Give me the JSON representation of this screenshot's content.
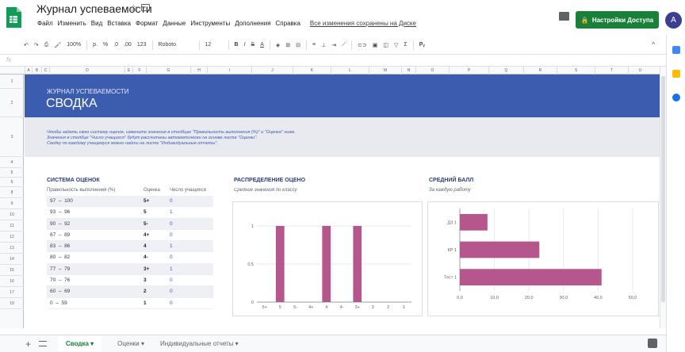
{
  "app": {
    "doc_title": "Журнал успеваемости",
    "menu": [
      "Файл",
      "Изменить",
      "Вид",
      "Вставка",
      "Формат",
      "Данные",
      "Инструменты",
      "Дополнения",
      "Справка"
    ],
    "saved_status": "Все изменения сохранены на Диске",
    "share_label": "Настройки Доступа",
    "avatar_letter": "A",
    "colors": {
      "share": "#188038",
      "header_band": "#3c5cb0",
      "bar": "#b5568c",
      "avatar": "#3c3f8f"
    }
  },
  "toolbar": {
    "zoom": "100%",
    "currency": "р.",
    "percent": "%",
    "dec_less": ".0",
    "dec_more": ".00",
    "format": "123",
    "font": "Roboto",
    "size": "12",
    "bold": "B",
    "italic": "I",
    "strike": "S",
    "underline": "A"
  },
  "formula_bar": {
    "fx": "fx"
  },
  "columns": [
    "A",
    "B",
    "C",
    "D",
    "E",
    "F",
    "G",
    "H",
    "I",
    "J",
    "K",
    "L",
    "M",
    "N",
    "O",
    "P",
    "Q",
    "R",
    "S",
    "T",
    "U"
  ],
  "rows": [
    "1",
    "2",
    "3",
    "4",
    "5",
    "6",
    "8",
    "9",
    "10",
    "11",
    "12",
    "13",
    "14",
    "15",
    "16",
    "17",
    "19"
  ],
  "header": {
    "kicker": "ЖУРНАЛ УСПЕВАЕМОСТИ",
    "title": "СВОДКА"
  },
  "instructions": [
    "Чтобы задать свою систему оценок, измените значения в столбцах \"Правильность выполнения (%)\" и \"Оценка\" ниже.",
    "Значения в столбце \"Число учащихся\" будут рассчитаны автоматически на основе листа \"Оценки\".",
    "Сводку по каждому учащемуся можно найти на листе \"Индивидуальные отчеты\"."
  ],
  "grading": {
    "title": "СИСТЕМА ОЦЕНОК",
    "col_range": "Правильность выполнения (%)",
    "col_grade": "Оценка",
    "col_count": "Число учащихся",
    "rows": [
      {
        "range": "97  –  100",
        "grade": "5+",
        "count": "0"
      },
      {
        "range": "93  –  96",
        "grade": "5",
        "count": "1"
      },
      {
        "range": "90  –  92",
        "grade": "5-",
        "count": "0"
      },
      {
        "range": "87  –  89",
        "grade": "4+",
        "count": "0"
      },
      {
        "range": "83  –  86",
        "grade": "4",
        "count": "1"
      },
      {
        "range": "80  –  82",
        "grade": "4-",
        "count": "0"
      },
      {
        "range": "77  –  79",
        "grade": "3+",
        "count": "1"
      },
      {
        "range": "70  –  76",
        "grade": "3",
        "count": "0"
      },
      {
        "range": "60  –  69",
        "grade": "2",
        "count": "0"
      },
      {
        "range": "0  –  59",
        "grade": "1",
        "count": "0"
      }
    ]
  },
  "distribution": {
    "title": "РАСПРЕДЕЛЕНИЕ ОЦЕНОК",
    "subtitle": "Средние значения по классу"
  },
  "average": {
    "title": "СРЕДНИЙ БАЛЛ",
    "subtitle": "За каждую работу"
  },
  "chart_data": [
    {
      "type": "bar",
      "title": "РАСПРЕДЕЛЕНИЕ ОЦЕНОК",
      "categories": [
        "5+",
        "5",
        "5-",
        "4+",
        "4",
        "4-",
        "3+",
        "3",
        "2",
        "1"
      ],
      "values": [
        0,
        1,
        0,
        0,
        1,
        0,
        1,
        0,
        0,
        0
      ],
      "ylim": [
        0,
        1
      ],
      "yticks": [
        "0",
        "0,5",
        "1"
      ],
      "color": "#b5568c"
    },
    {
      "type": "bar",
      "orientation": "horizontal",
      "title": "СРЕДНИЙ БАЛЛ",
      "categories": [
        "ДЗ 1",
        "КР 1",
        "Тест 1"
      ],
      "values": [
        8,
        23,
        41
      ],
      "xlim": [
        0,
        50
      ],
      "xticks": [
        "0,0",
        "10,0",
        "20,0",
        "30,0",
        "40,0",
        "50,0"
      ],
      "color": "#b5568c"
    }
  ],
  "sheet_tabs": [
    {
      "label": "Сводка",
      "active": true
    },
    {
      "label": "Оценки",
      "active": false
    },
    {
      "label": "Индивидуальные отчеты",
      "active": false
    }
  ]
}
